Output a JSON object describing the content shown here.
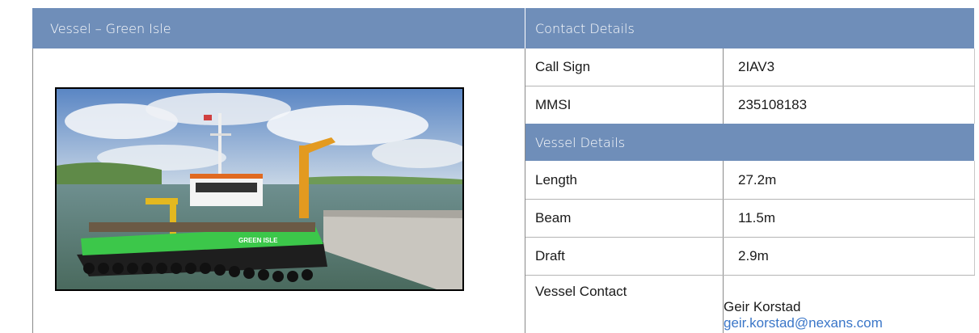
{
  "left_panel": {
    "title": "Vessel – Green Isle",
    "photo_alt": "Green Isle vessel moored at harbour wall",
    "hull_text": "GREEN ISLE"
  },
  "contact_details": {
    "header": "Contact Details",
    "rows": [
      {
        "label": "Call Sign",
        "value": "2IAV3"
      },
      {
        "label": "MMSI",
        "value": "235108183"
      }
    ]
  },
  "vessel_details": {
    "header": "Vessel Details",
    "rows": [
      {
        "label": "Length",
        "value": "27.2m"
      },
      {
        "label": "Beam",
        "value": "11.5m"
      },
      {
        "label": "Draft",
        "value": "2.9m"
      }
    ],
    "contact": {
      "label": "Vessel Contact",
      "name": "Geir Korstad",
      "email": "geir.korstad@nexans.com"
    }
  },
  "colors": {
    "header_bg": "#6f8eb9",
    "header_text": "#ffffff",
    "link": "#3a76c8",
    "hull_green": "#3cc74a"
  }
}
